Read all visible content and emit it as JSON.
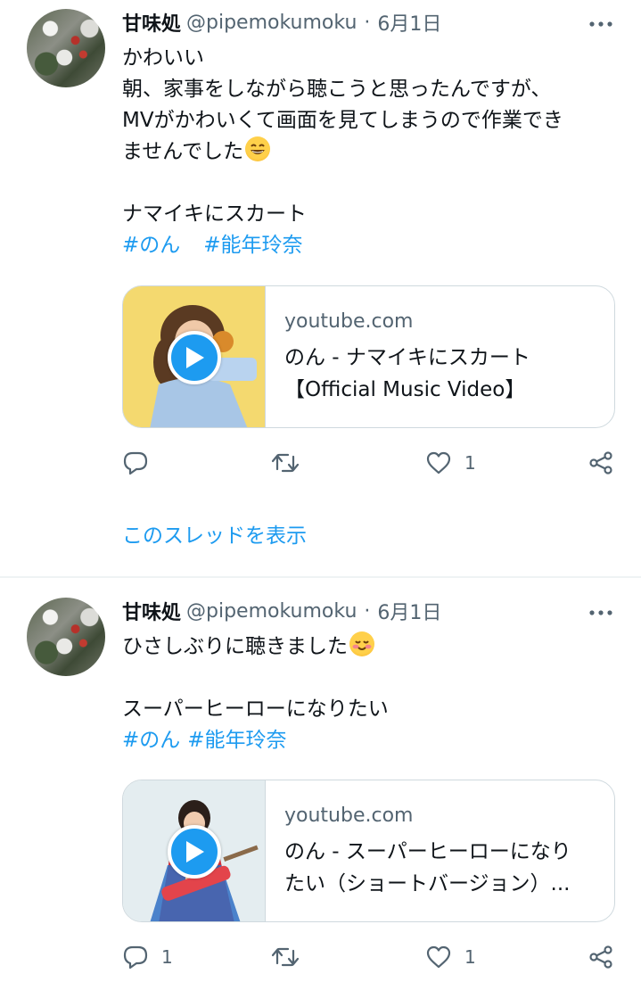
{
  "tweets": [
    {
      "display_name": "甘味処",
      "handle": "@pipemokumoku",
      "separator": "·",
      "date": "6月1日",
      "text_lines": [
        "かわいい",
        "朝、家事をしながら聴こうと思ったんですが、",
        "MVがかわいくて画面を見てしまうので作業でき",
        "ませんでした"
      ],
      "emoji": "grinning-squinting-face",
      "song_line": "ナマイキにスカート",
      "hashtags": [
        "#のん",
        "#能年玲奈"
      ],
      "card": {
        "domain": "youtube.com",
        "title_lines": [
          "のん - ナマイキにスカート",
          "【Official Music Video】"
        ]
      },
      "actions": {
        "reply_count": "",
        "retweet_count": "",
        "like_count": "1"
      },
      "thread_link": "このスレッドを表示"
    },
    {
      "display_name": "甘味処",
      "handle": "@pipemokumoku",
      "separator": "·",
      "date": "6月1日",
      "text_lines": [
        "ひさしぶりに聴きました"
      ],
      "emoji": "smiling-face-with-blush",
      "song_line": "スーパーヒーローになりたい",
      "hashtags": [
        "#のん",
        "#能年玲奈"
      ],
      "card": {
        "domain": "youtube.com",
        "title_lines": [
          "のん - スーパーヒーローになり",
          "たい（ショートバージョン）..."
        ]
      },
      "actions": {
        "reply_count": "1",
        "retweet_count": "",
        "like_count": "1"
      }
    }
  ],
  "colors": {
    "link_blue": "#1d9bf0",
    "muted_text": "#536471",
    "primary_text": "#0f1419",
    "border": "#cfd9de"
  }
}
